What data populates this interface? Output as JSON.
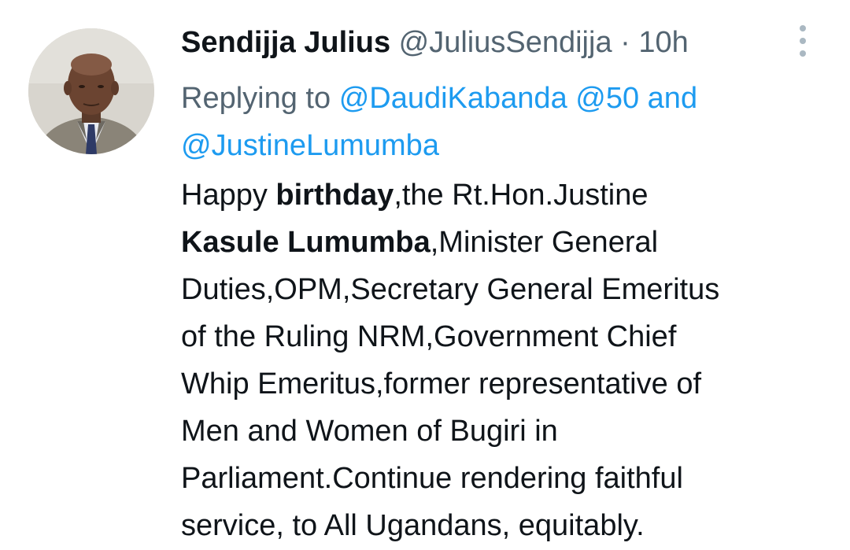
{
  "tweet": {
    "author_name": "Sendijja Julius",
    "author_handle": "@JuliusSendijja",
    "separator": "·",
    "time": "10h",
    "reply_prefix": "Replying to",
    "reply_mention_1": "@DaudiKabanda",
    "reply_mention_2": "@50",
    "reply_and": "and",
    "reply_mention_3": "@JustineLumumba",
    "body_lines": [
      [
        "Happy ",
        "birthday",
        ",the Rt.Hon.Justine"
      ],
      [
        "",
        "Kasule Lumumba",
        ",Minister General"
      ],
      [
        "Duties,OPM,Secretary General Emeritus"
      ],
      [
        "of the Ruling NRM,Government Chief"
      ],
      [
        "Whip Emeritus,former representative of"
      ],
      [
        "Men and Women of Bugiri in"
      ],
      [
        "Parliament.Continue rendering faithful"
      ],
      [
        "service, to All Ugandans, equitably."
      ]
    ],
    "icons": {
      "more": "more-vertical-icon",
      "avatar": "profile-photo"
    },
    "colors": {
      "text": "#0f1419",
      "secondary": "#536471",
      "link": "#1d9bf0"
    }
  }
}
